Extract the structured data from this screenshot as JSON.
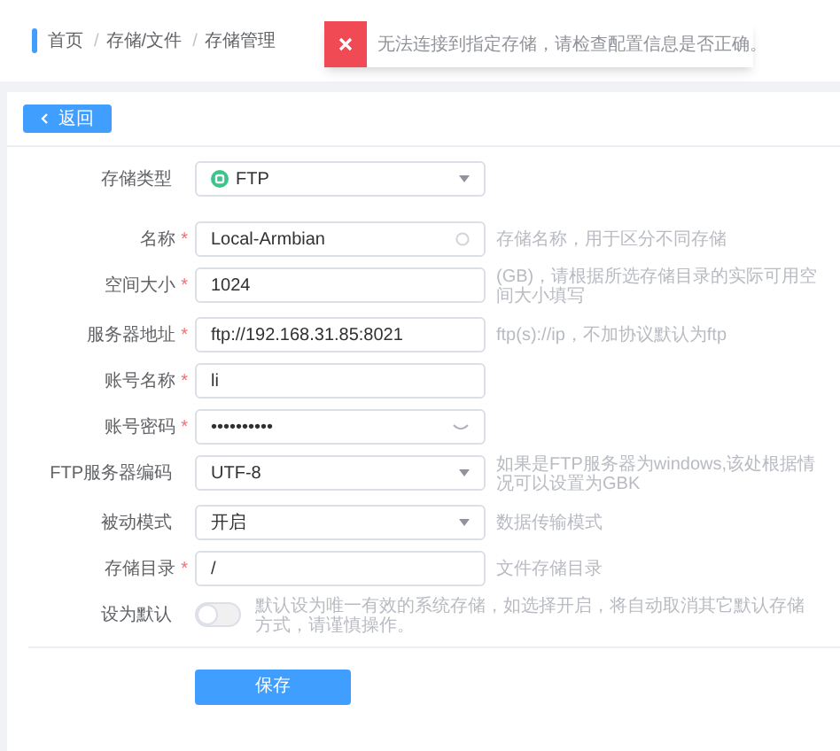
{
  "breadcrumb": [
    "首页",
    "存储/文件",
    "存储管理"
  ],
  "breadcrumb_separator": "/",
  "required_mark": "*",
  "toast": {
    "message": "无法连接到指定存储，请检查配置信息是否正确。"
  },
  "back_button": "返回",
  "fields": [
    {
      "kind": "select",
      "label": "存储类型",
      "required": false,
      "value": "FTP",
      "badge": true
    },
    {
      "kind": "input",
      "label": "名称",
      "required": true,
      "value": "Local-Armbian",
      "hint": "存储名称，用于区分不同存储",
      "clearable": true
    },
    {
      "kind": "input",
      "label": "空间大小",
      "required": true,
      "value": "1024",
      "hint": "(GB)，请根据所选存储目录的实际可用空间大小填写"
    },
    {
      "kind": "input",
      "label": "服务器地址",
      "required": true,
      "value": "ftp://192.168.31.85:8021",
      "hint": "ftp(s)://ip，不加协议默认为ftp"
    },
    {
      "kind": "input",
      "label": "账号名称",
      "required": true,
      "value": "li"
    },
    {
      "kind": "password",
      "label": "账号密码",
      "required": true,
      "value": "••••••••••"
    },
    {
      "kind": "select",
      "label": "FTP服务器编码",
      "required": false,
      "value": "UTF-8",
      "hint": "如果是FTP服务器为windows,该处根据情况可以设置为GBK"
    },
    {
      "kind": "select",
      "label": "被动模式",
      "required": false,
      "value": "开启",
      "hint": "数据传输模式"
    },
    {
      "kind": "input",
      "label": "存储目录",
      "required": true,
      "value": "/",
      "hint": "文件存储目录"
    },
    {
      "kind": "switch",
      "label": "设为默认",
      "required": false,
      "on": false,
      "hint": "默认设为唯一有效的系统存储，如选择开启，将自动取消其它默认存储方式，请谨慎操作。"
    }
  ],
  "save_button": "保存"
}
